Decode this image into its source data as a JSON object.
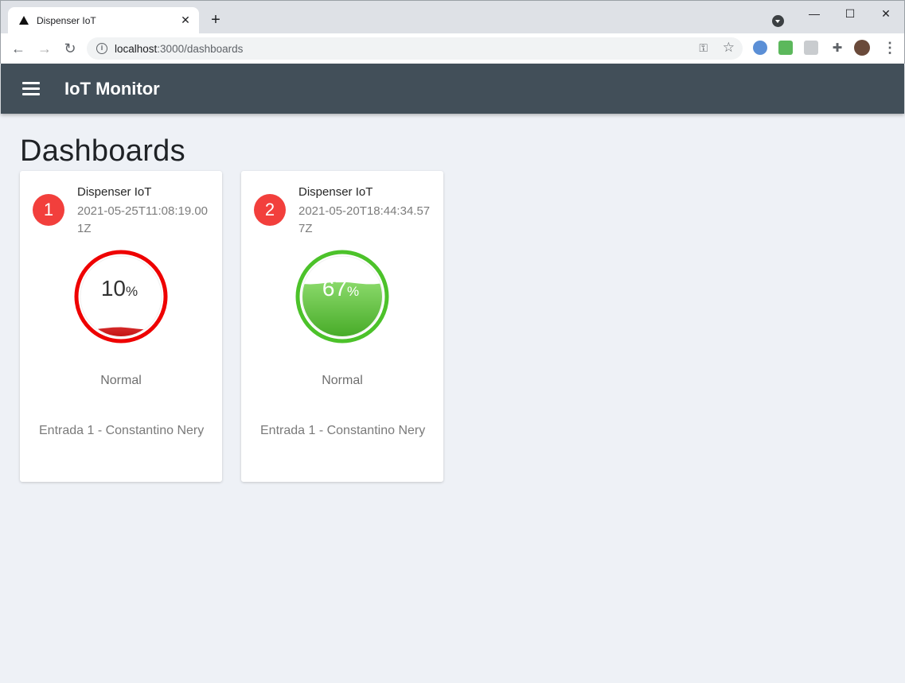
{
  "browser": {
    "tab_title": "Dispenser IoT",
    "url_host": "localhost",
    "url_rest": ":3000/dashboards"
  },
  "app": {
    "title": "IoT Monitor",
    "page_title": "Dashboards"
  },
  "cards": [
    {
      "number": "1",
      "name": "Dispenser IoT",
      "timestamp": "2021-05-25T11:08:19.001Z",
      "level_percent": 10,
      "level_text": "10",
      "unit": "%",
      "status": "Normal",
      "location": "Entrada 1 - Constantino Nery",
      "color": "#ee0000",
      "fill_top": "#d42a2a",
      "fill_bottom": "#b80000"
    },
    {
      "number": "2",
      "name": "Dispenser IoT",
      "timestamp": "2021-05-20T18:44:34.577Z",
      "level_percent": 67,
      "level_text": "67",
      "unit": "%",
      "status": "Normal",
      "location": "Entrada 1 - Constantino Nery",
      "color": "#4cc22a",
      "fill_top": "#8ad96a",
      "fill_bottom": "#3ea51f"
    }
  ],
  "colors": {
    "appbar": "#424f59",
    "badge": "#f23f3c",
    "background": "#eef1f6"
  }
}
